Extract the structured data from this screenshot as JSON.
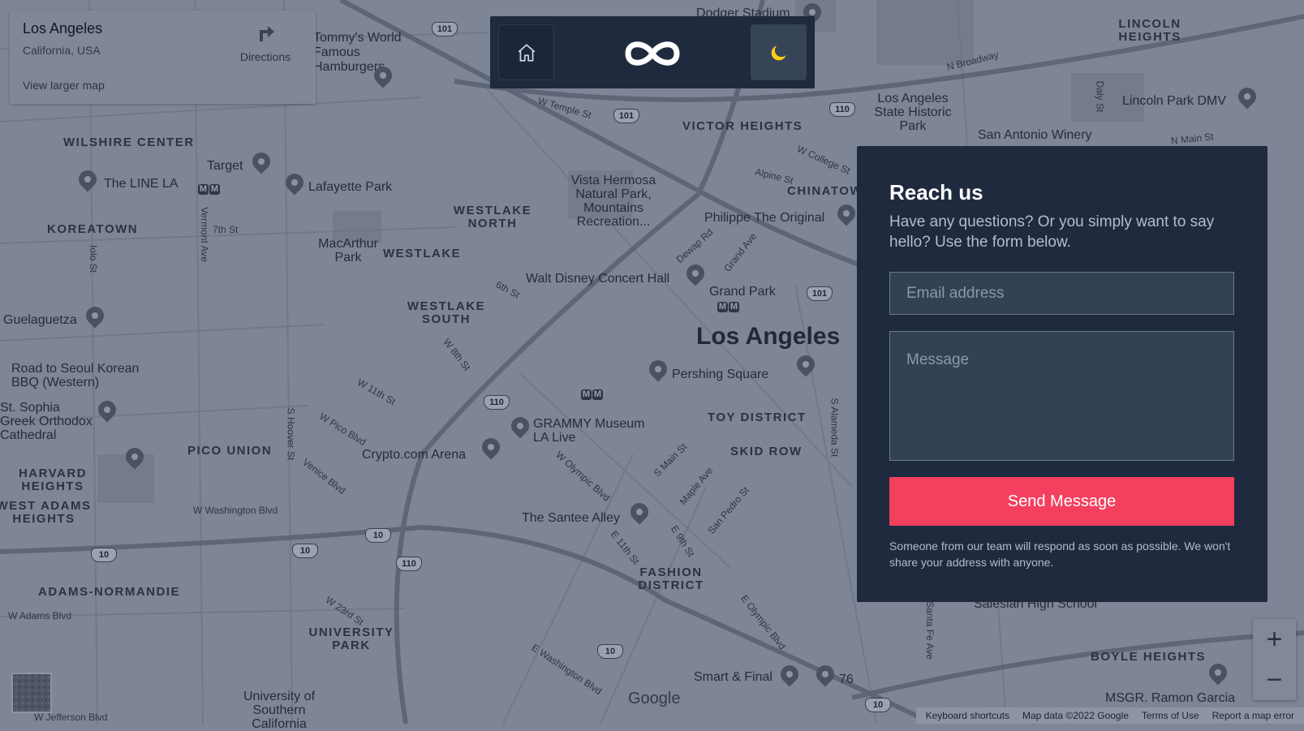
{
  "map": {
    "districts": [
      "WILSHIRE CENTER",
      "KOREATOWN",
      "WESTLAKE NORTH",
      "WESTLAKE",
      "WESTLAKE SOUTH",
      "VICTOR HEIGHTS",
      "CHINATOWN",
      "LINCOLN HEIGHTS",
      "PICO UNION",
      "HARVARD HEIGHTS",
      "WEST ADAMS HEIGHTS",
      "ADAMS-NORMANDIE",
      "UNIVERSITY PARK",
      "TOY DISTRICT",
      "SKID ROW",
      "FASHION DISTRICT",
      "BOYLE HEIGHTS"
    ],
    "places": [
      "Target",
      "The LINE LA",
      "Lafayette Park",
      "Tommy's World Famous Hamburgers",
      "Vista Hermosa Natural Park, Mountains Recreation...",
      "MacArthur Park",
      "Walt Disney Concert Hall",
      "Grand Park",
      "Los Angeles State Historic Park",
      "Lincoln Park DMV",
      "San Antonio Winery",
      "Philippe The Original",
      "Guelaguetza",
      "Road to Seoul Korean BBQ (Western)",
      "St. Sophia Greek Orthodox Cathedral",
      "Crypto.com Arena",
      "GRAMMY Museum LA Live",
      "Pershing Square",
      "The Santee Alley",
      "Smart & Final",
      "76",
      "University of Southern California",
      "MSGR. Ramon Garcia",
      "Dodger Stadium",
      "Salesian High School"
    ],
    "city_label": "Los Angeles",
    "streets": [
      "W Temple St",
      "N Broadway",
      "W College St",
      "Alpine St",
      "Dewap Rd",
      "Grand Ave",
      "6th St",
      "W 8th St",
      "W 11th St",
      "W Pico Blvd",
      "Venice Blvd",
      "W Washington Blvd",
      "W Olympic Blvd",
      "S Main St",
      "Maple Ave",
      "San Pedro St",
      "E 11th St",
      "E 9th St",
      "W 23rd St",
      "E Washington Blvd",
      "E Olympic Blvd",
      "S Alameda St",
      "S Hoover St",
      "Vermont Ave",
      "7th St",
      "W Adams Blvd",
      "W Jefferson Blvd",
      "Daly St",
      "N Main St",
      "Iolo St",
      "Santa Fe Ave"
    ],
    "highways": [
      "101",
      "110",
      "10"
    ]
  },
  "card": {
    "title": "Los Angeles",
    "subtitle": "California, USA",
    "directions": "Directions",
    "larger_map": "View larger map"
  },
  "nav": {
    "home_icon": "home-icon",
    "logo_icon": "infinity-logo",
    "theme_icon": "moon-icon"
  },
  "form": {
    "title": "Reach us",
    "description": "Have any questions? Or you simply want to say hello? Use the form below.",
    "email_placeholder": "Email address",
    "message_placeholder": "Message",
    "send_label": "Send Message",
    "note": "Someone from our team will respond as soon as possible. We won't share your address with anyone."
  },
  "controls": {
    "zoom_in": "+",
    "zoom_out": "−",
    "google": "Google",
    "footer": [
      "Keyboard shortcuts",
      "Map data ©2022 Google",
      "Terms of Use",
      "Report a map error"
    ]
  },
  "colors": {
    "panel": "#1f2a3f",
    "accent": "#f43f5e",
    "map": "#7d8596",
    "moon": "#facc15"
  }
}
